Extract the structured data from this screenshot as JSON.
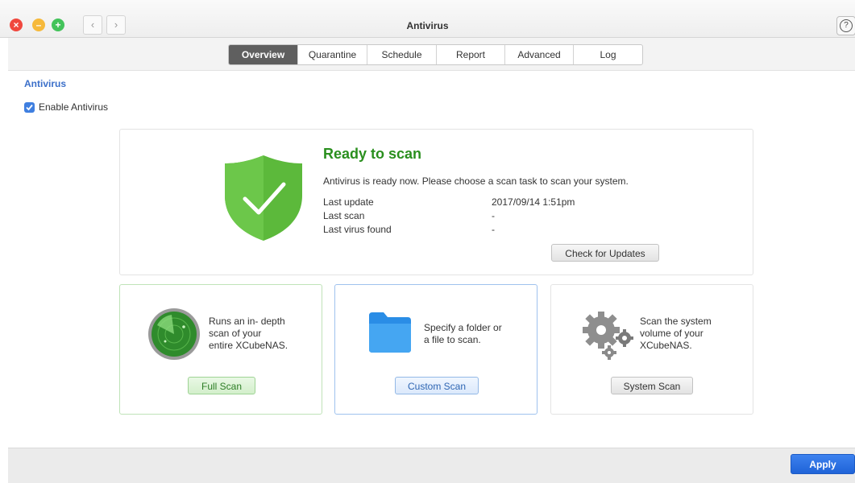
{
  "window": {
    "title": "Antivirus"
  },
  "tabs": [
    {
      "label": "Overview",
      "active": true
    },
    {
      "label": "Quarantine",
      "active": false
    },
    {
      "label": "Schedule",
      "active": false
    },
    {
      "label": "Report",
      "active": false
    },
    {
      "label": "Advanced",
      "active": false
    },
    {
      "label": "Log",
      "active": false
    }
  ],
  "section": {
    "title": "Antivirus",
    "enable_label": "Enable Antivirus",
    "enabled": true
  },
  "status": {
    "title": "Ready to scan",
    "description": "Antivirus is ready now. Please choose a scan task to scan your system.",
    "rows": [
      {
        "label": "Last update",
        "value": "2017/09/14 1:51pm"
      },
      {
        "label": "Last scan",
        "value": "-"
      },
      {
        "label": "Last virus found",
        "value": "-"
      }
    ],
    "update_button": "Check for Updates"
  },
  "scans": {
    "full": {
      "lines": [
        "Runs an in- depth",
        "scan of your",
        "entire XCubeNAS."
      ],
      "button": "Full Scan"
    },
    "custom": {
      "lines": [
        "Specify a folder or",
        "a file to scan."
      ],
      "button": "Custom Scan"
    },
    "system": {
      "lines": [
        "Scan the system",
        "volume of your",
        "XCubeNAS."
      ],
      "button": "System Scan"
    }
  },
  "footer": {
    "apply_label": "Apply"
  },
  "colors": {
    "accent": "#3f7fe0",
    "status_green": "#2a8f1e",
    "apply_blue": "#2b6fe3"
  },
  "icons": [
    "close-icon",
    "minimize-icon",
    "maximize-icon",
    "back-icon",
    "forward-icon",
    "help-icon",
    "shield-check-icon",
    "radar-icon",
    "folder-icon",
    "gears-icon",
    "checkbox-check-icon"
  ]
}
